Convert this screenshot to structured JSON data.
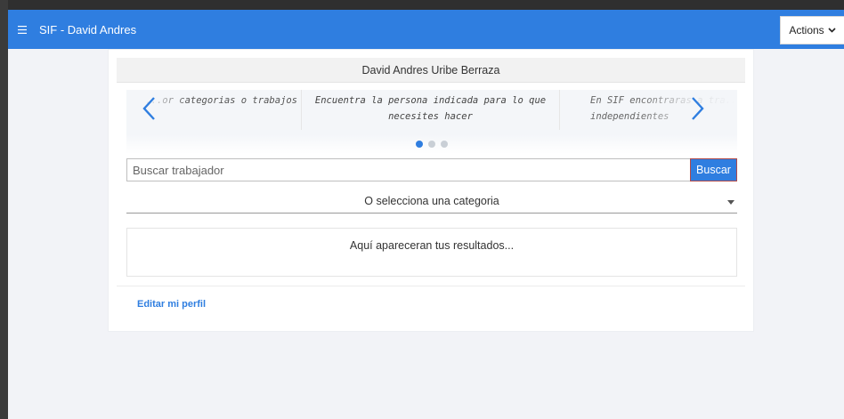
{
  "app_bar": {
    "title": "SIF - David Andres",
    "menu_icon": "hamburger-menu-icon",
    "actions_label": "Actions",
    "actions_icon": "chevron-down-icon",
    "color": "#2f7ee0"
  },
  "profile": {
    "name": "David Andres Uribe Berraza"
  },
  "carousel": {
    "slides": [
      "...or categorias o trabajos",
      "Encuentra la persona indicada para lo que necesites hacer",
      "En SIF encontraras a tra... independientes"
    ],
    "active_index": 1,
    "dot_count": 3,
    "prev_icon": "chevron-left-icon",
    "next_icon": "chevron-right-icon"
  },
  "search": {
    "placeholder": "Buscar trabajador",
    "value": "",
    "button_label": "Buscar"
  },
  "category": {
    "selected": "O selecciona una categoria"
  },
  "results": {
    "placeholder_text": "Aquí apareceran tus resultados..."
  },
  "footer": {
    "edit_profile_label": "Editar mi perfil"
  }
}
